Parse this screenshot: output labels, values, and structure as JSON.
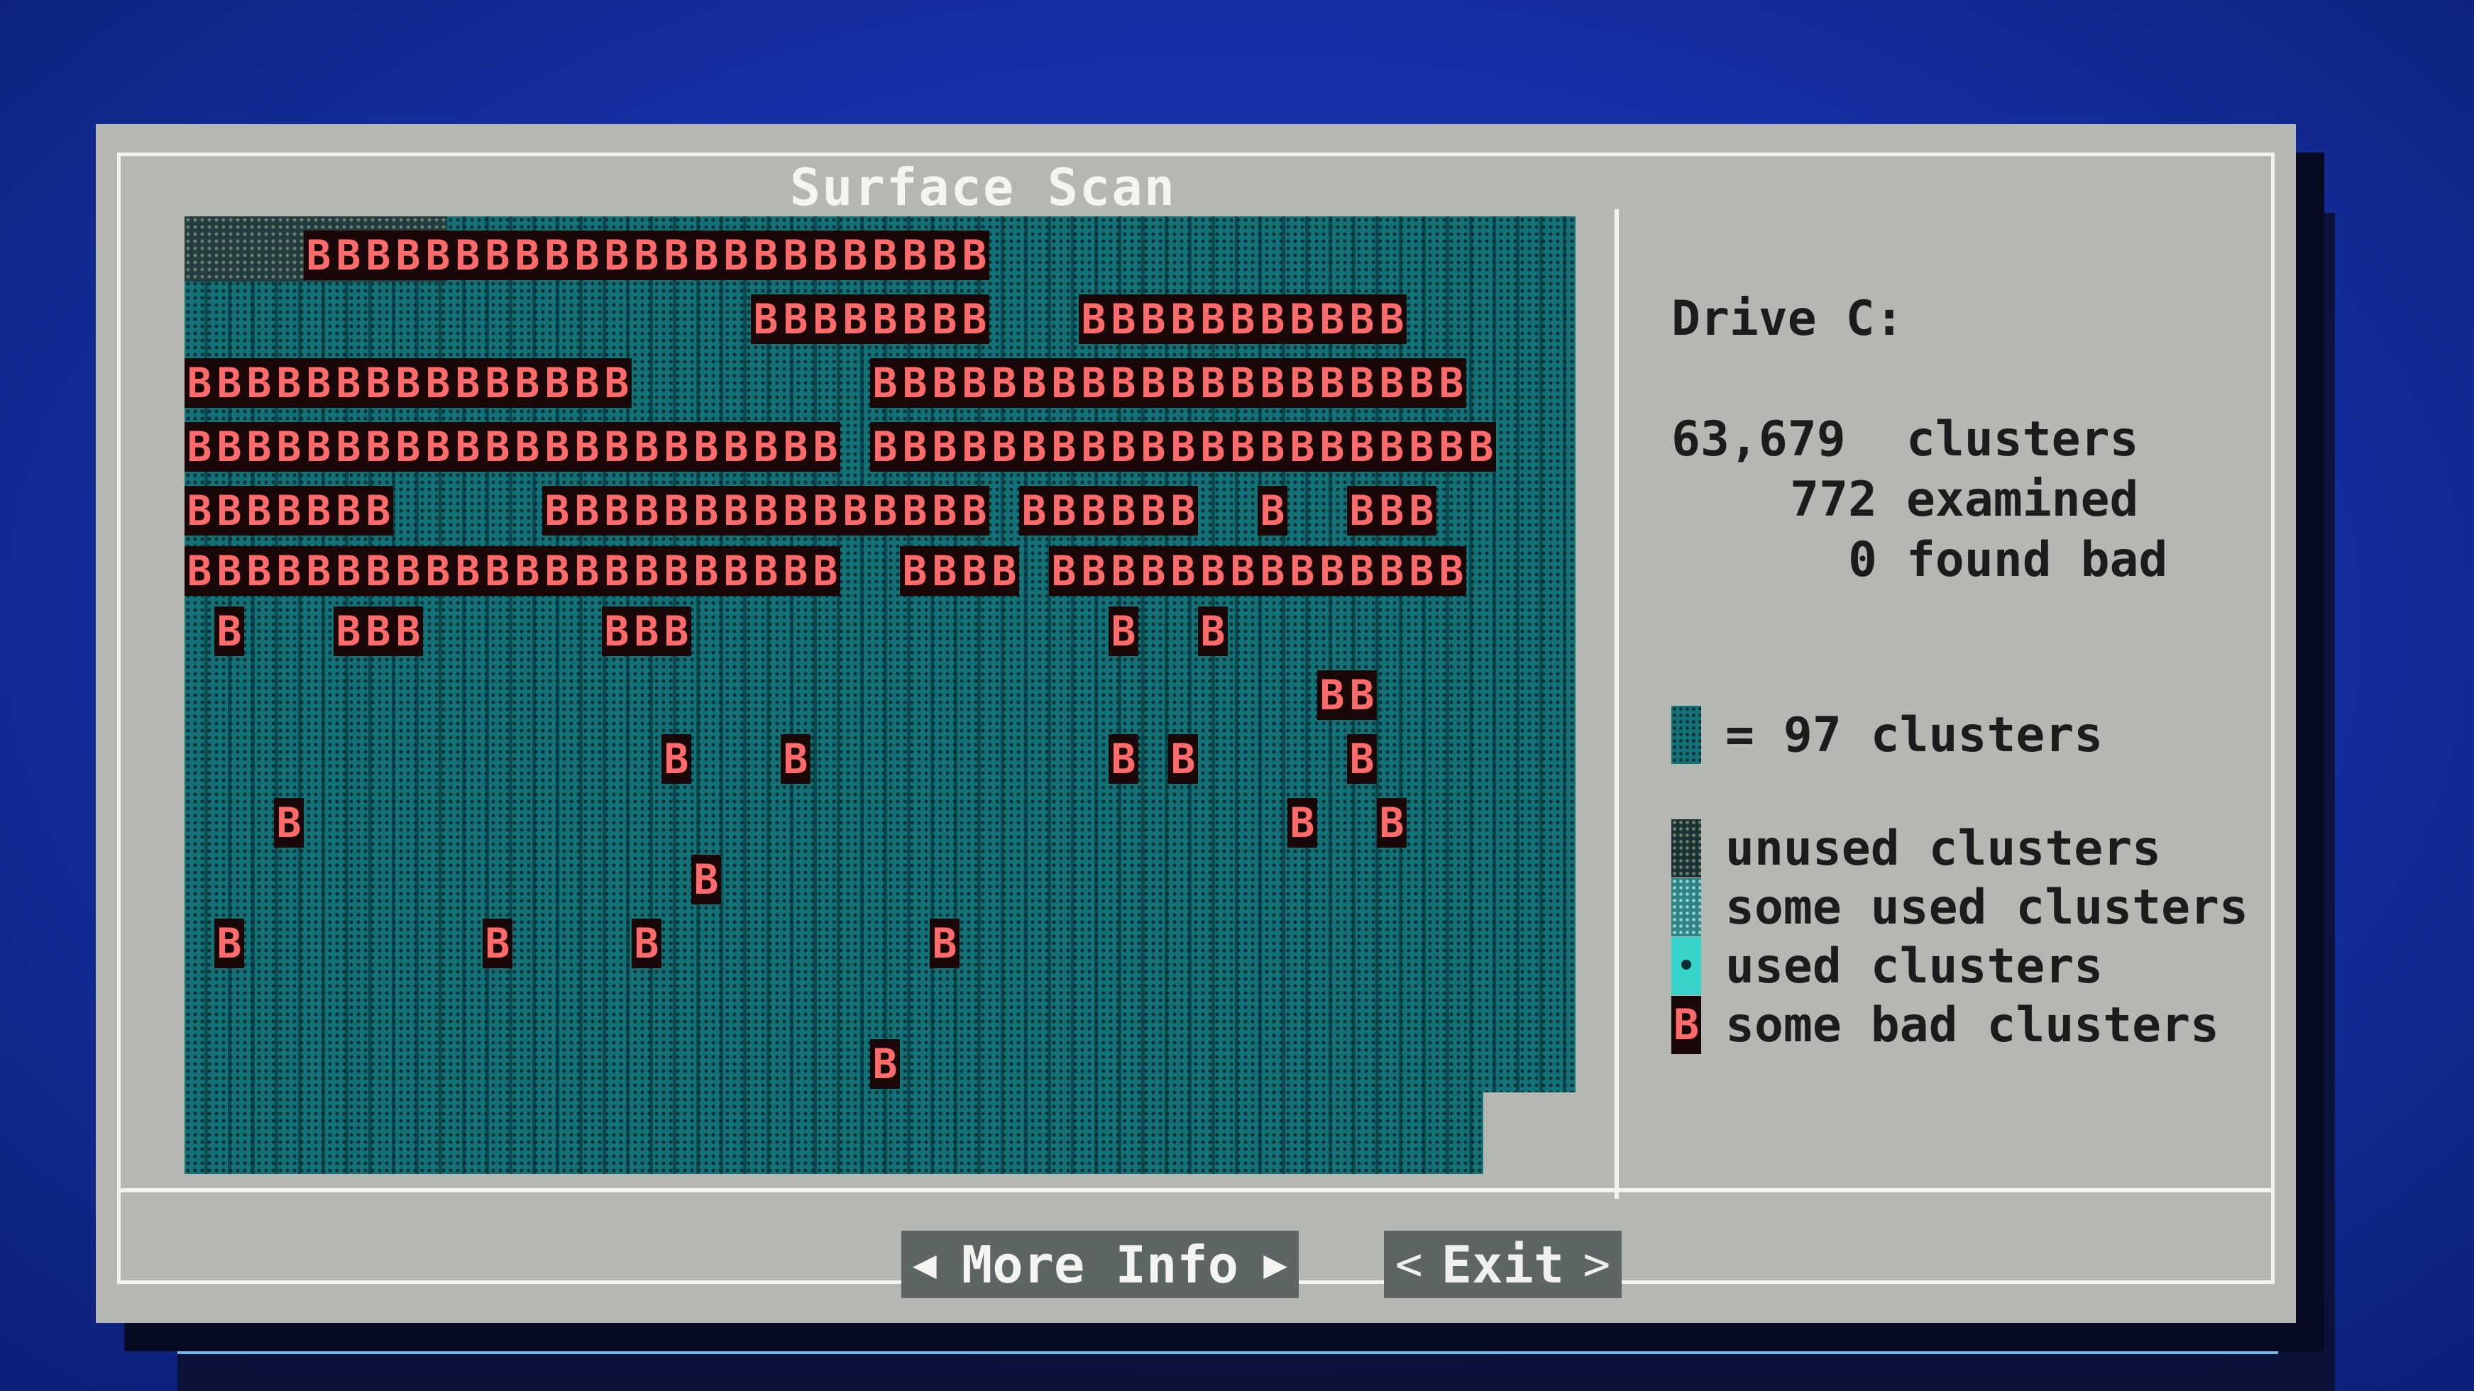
{
  "dialog": {
    "title": "Surface Scan"
  },
  "map": {
    "bad_char": "B",
    "rows": [
      "    BBBBBBBBBBBBBBBBBBBBBBB            ",
      "                   BBBBBBBB   BBBBBBBBBBB",
      "BBBBBBBBBBBBBBB        BBBBBBBBBBBBBBBBBBBB",
      "BBBBBBBBBBBBBBBBBBBBBB BBBBBBBBBBBBBBBBBBBBB",
      "BBBBBBB     BBBBBBBBBBBBBBB BBBBBB  B  BBB",
      "BBBBBBBBBBBBBBBBBBBBBB  BBBB BBBBBBBBBBBBBB",
      " B   BBB      BBB              B  B     ",
      "                                      BB",
      "                B   B          B B     B",
      "   B                                 B  B",
      "                 B                       ",
      " B        B    B         B               ",
      "                                        ",
      "                       B                "
    ]
  },
  "info": {
    "drive_label": "Drive C:",
    "clusters_value": "63,679",
    "clusters_label": "clusters",
    "examined_value": "772",
    "examined_label": "examined",
    "bad_value": "0",
    "bad_label": "found bad",
    "block_scale": "= 97 clusters"
  },
  "legend": {
    "unused": "unused clusters",
    "some_used": "some used clusters",
    "used": "used clusters",
    "some_bad": "some bad clusters",
    "used_glyph": "•",
    "bad_glyph": "B"
  },
  "buttons": {
    "more_info_label": "More Info",
    "more_left_arrow": "◀",
    "more_right_arrow": "▶",
    "exit_label": "Exit",
    "exit_left": "<",
    "exit_right": ">"
  },
  "colors": {
    "screen_blue": "#1530a4",
    "dialog_gray": "#b5b7b3",
    "map_teal": "#127277",
    "bad_red": "#ff6b6b",
    "button_gray": "#5d6664"
  }
}
